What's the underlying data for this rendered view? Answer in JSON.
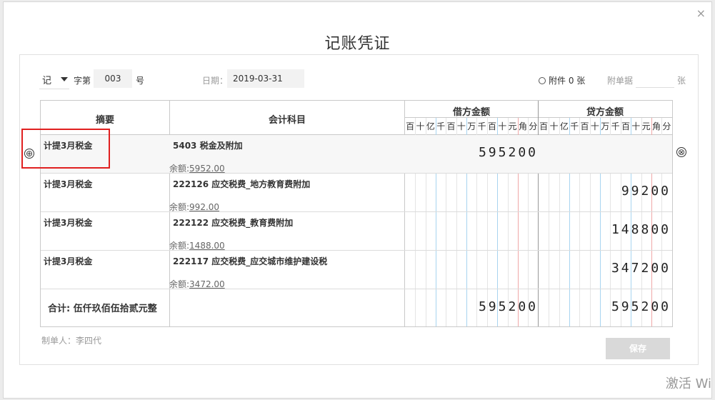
{
  "dialog": {
    "title": "记账凭证",
    "close": "×"
  },
  "header": {
    "voucher_type": "记",
    "zi_label": "字第",
    "number": "003",
    "hao_label": "号",
    "date_label": "日期：",
    "date_value": "2019-03-31",
    "attachment": "附件 0 张",
    "doc_label": "附单据",
    "doc_value": "",
    "zhang_label": "张"
  },
  "table": {
    "col_summary": "摘要",
    "col_account": "会计科目",
    "col_debit": "借方金额",
    "col_credit": "贷方金额",
    "digit_units": [
      "百",
      "十",
      "亿",
      "千",
      "百",
      "十",
      "万",
      "千",
      "百",
      "十",
      "元",
      "角",
      "分"
    ],
    "rows": [
      {
        "summary": "计提3月税金",
        "account": "5403 税金及附加",
        "balance_label": "余额:",
        "balance": "5952.00",
        "debit": "595200",
        "credit": ""
      },
      {
        "summary": "计提3月税金",
        "account": "222126 应交税费_地方教育费附加",
        "balance_label": "余额:",
        "balance": "992.00",
        "debit": "",
        "credit": "99200"
      },
      {
        "summary": "计提3月税金",
        "account": "222122 应交税费_教育费附加",
        "balance_label": "余额:",
        "balance": "1488.00",
        "debit": "",
        "credit": "148800"
      },
      {
        "summary": "计提3月税金",
        "account": "222117 应交税费_应交城市维护建设税",
        "balance_label": "余额:",
        "balance": "3472.00",
        "debit": "",
        "credit": "347200"
      }
    ],
    "total_label": "合计:  伍仟玖佰伍拾贰元整",
    "total_debit": "595200",
    "total_credit": "595200"
  },
  "footer": {
    "creator": "制单人：李四代",
    "save": "保存"
  },
  "icons": {
    "add": "⊕",
    "remove": "⊗"
  },
  "watermark": "激活 Wi"
}
